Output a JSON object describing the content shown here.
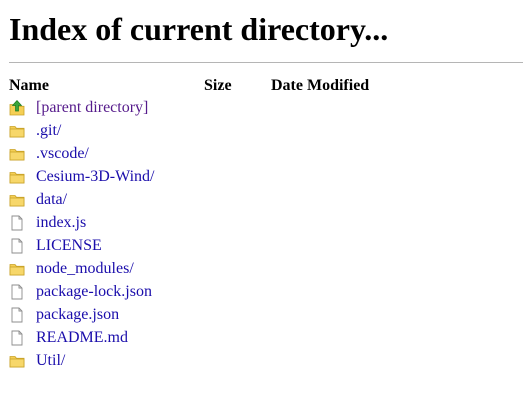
{
  "page": {
    "title": "Index of current directory..."
  },
  "table": {
    "headers": {
      "name": "Name",
      "size": "Size",
      "modified": "Date Modified"
    },
    "rows": [
      {
        "name": "[parent directory]",
        "icon": "parent-directory-icon",
        "size": "",
        "modified": ""
      },
      {
        "name": ".git/",
        "icon": "folder-icon",
        "size": "",
        "modified": ""
      },
      {
        "name": ".vscode/",
        "icon": "folder-icon",
        "size": "",
        "modified": ""
      },
      {
        "name": "Cesium-3D-Wind/",
        "icon": "folder-icon",
        "size": "",
        "modified": ""
      },
      {
        "name": "data/",
        "icon": "folder-icon",
        "size": "",
        "modified": ""
      },
      {
        "name": "index.js",
        "icon": "file-icon",
        "size": "",
        "modified": ""
      },
      {
        "name": "LICENSE",
        "icon": "file-icon",
        "size": "",
        "modified": ""
      },
      {
        "name": "node_modules/",
        "icon": "folder-icon",
        "size": "",
        "modified": ""
      },
      {
        "name": "package-lock.json",
        "icon": "file-icon",
        "size": "",
        "modified": ""
      },
      {
        "name": "package.json",
        "icon": "file-icon",
        "size": "",
        "modified": ""
      },
      {
        "name": "README.md",
        "icon": "file-icon",
        "size": "",
        "modified": ""
      },
      {
        "name": "Util/",
        "icon": "folder-icon",
        "size": "",
        "modified": ""
      }
    ]
  },
  "colors": {
    "link": "#1a0dab",
    "visited": "#551a8b",
    "folder": "#f2c94c"
  }
}
